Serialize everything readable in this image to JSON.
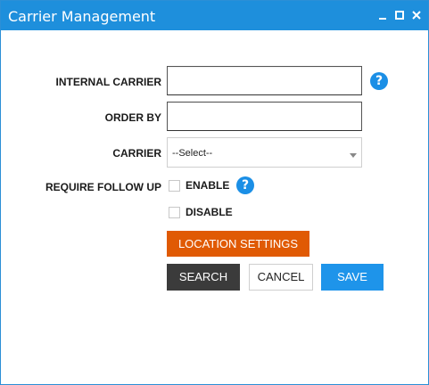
{
  "window": {
    "title": "Carrier Management",
    "controls": {
      "minimize": "minimize-icon",
      "maximize": "maximize-icon",
      "close": "close-icon"
    }
  },
  "form": {
    "internal_carrier": {
      "label": "INTERNAL CARRIER",
      "value": ""
    },
    "order_by": {
      "label": "ORDER BY",
      "value": ""
    },
    "carrier": {
      "label": "CARRIER",
      "selected": "--Select--"
    },
    "require_follow_up": {
      "label": "REQUIRE FOLLOW UP",
      "options": [
        {
          "label": "ENABLE",
          "checked": false
        },
        {
          "label": "DISABLE",
          "checked": false
        }
      ]
    }
  },
  "buttons": {
    "location_settings": "LOCATION SETTINGS",
    "search": "SEARCH",
    "cancel": "CANCEL",
    "save": "SAVE"
  },
  "help_glyph": "?",
  "colors": {
    "titlebar": "#1e8fdc",
    "help": "#1b8fe6",
    "location_button": "#e05a04",
    "search_button": "#3b3b3b",
    "save_button": "#1e94ea"
  }
}
